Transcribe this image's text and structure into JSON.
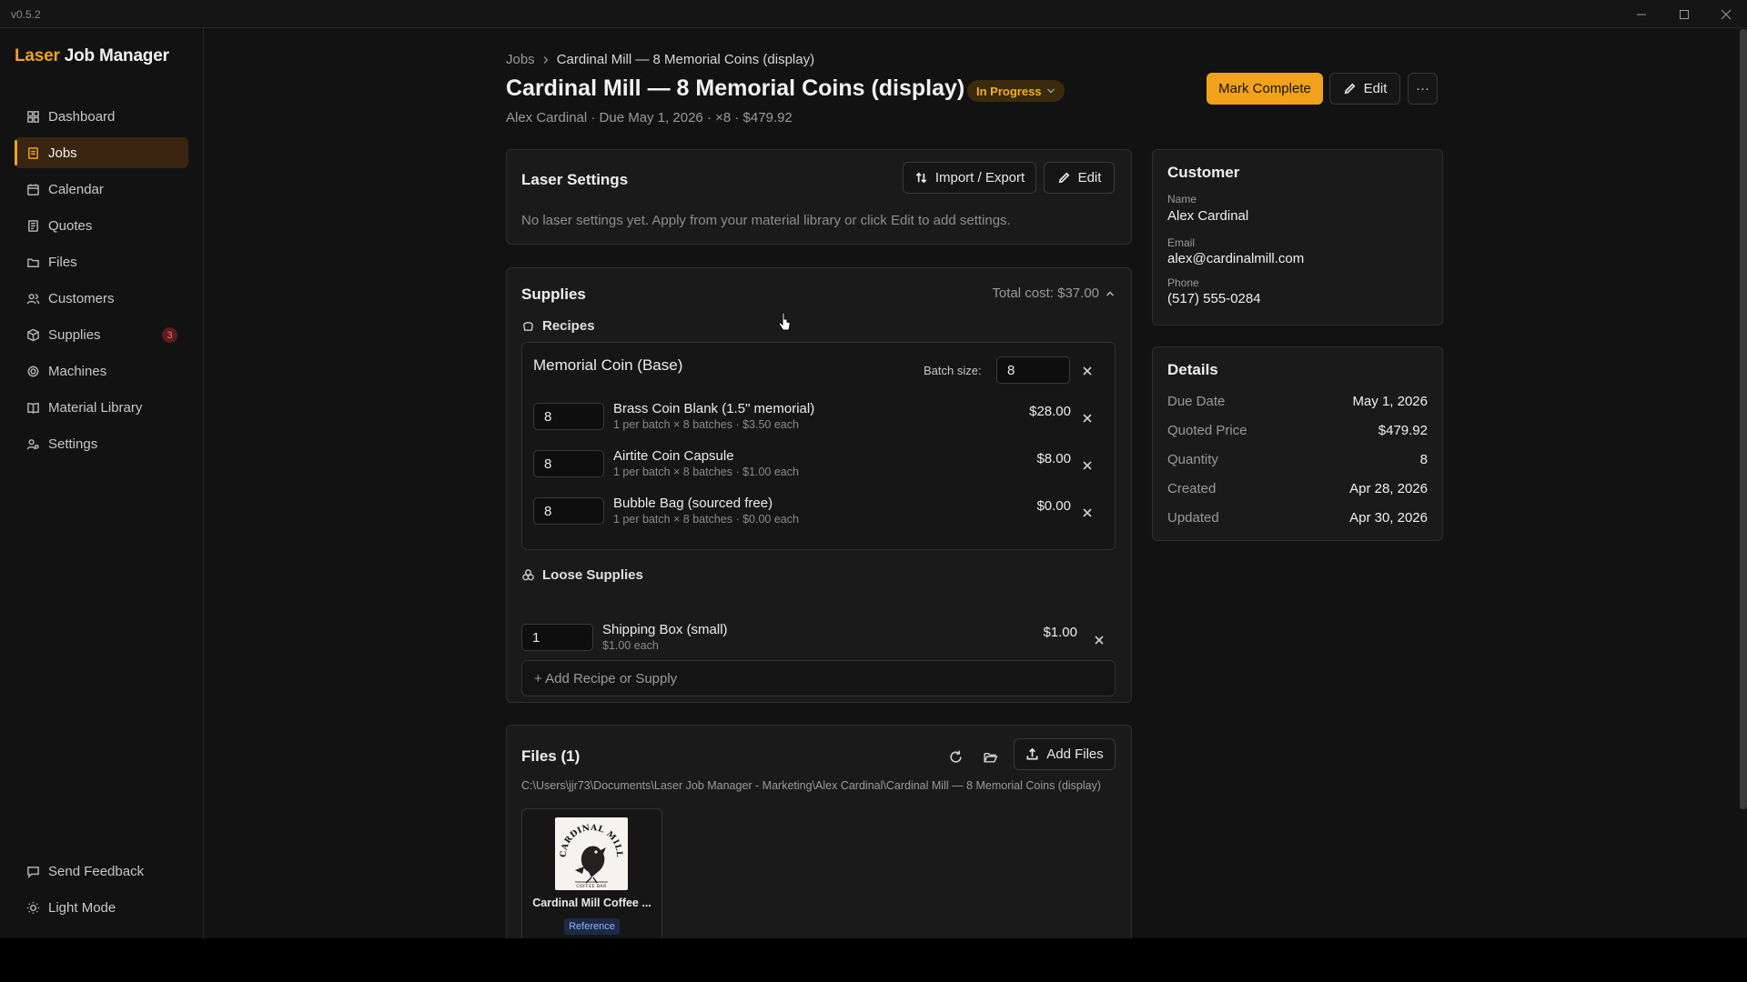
{
  "app": {
    "version": "v0.5.2",
    "brand_accent": "Laser",
    "brand_rest": " Job Manager",
    "accent_color": "#f0a21b"
  },
  "sidebar": {
    "items": [
      {
        "label": "Dashboard",
        "icon": "dashboard-icon"
      },
      {
        "label": "Jobs",
        "icon": "jobs-icon",
        "active": true
      },
      {
        "label": "Calendar",
        "icon": "calendar-icon"
      },
      {
        "label": "Quotes",
        "icon": "quotes-icon"
      },
      {
        "label": "Files",
        "icon": "folder-icon"
      },
      {
        "label": "Customers",
        "icon": "customers-icon"
      },
      {
        "label": "Supplies",
        "icon": "supplies-icon",
        "badge": "3"
      },
      {
        "label": "Machines",
        "icon": "machine-icon"
      },
      {
        "label": "Material Library",
        "icon": "book-icon"
      },
      {
        "label": "Settings",
        "icon": "settings-icon"
      }
    ],
    "feedback": "Send Feedback",
    "theme_toggle": "Light Mode"
  },
  "header": {
    "breadcrumb_root": "Jobs",
    "breadcrumb_current": "Cardinal Mill — 8 Memorial Coins (display)",
    "title": "Cardinal Mill — 8 Memorial Coins (display)",
    "status": "In Progress",
    "subtitle": "Alex Cardinal · Due May 1, 2026 · ×8 · $479.92",
    "mark_complete": "Mark Complete",
    "edit": "Edit",
    "more": "···"
  },
  "laser_settings": {
    "title": "Laser Settings",
    "import_export": "Import / Export",
    "edit": "Edit",
    "empty": "No laser settings yet. Apply from your material library or click Edit to add settings."
  },
  "supplies": {
    "title": "Supplies",
    "total": "Total cost: $37.00",
    "recipes_label": "Recipes",
    "recipe": {
      "name": "Memorial Coin (Base)",
      "batch_label": "Batch size:",
      "batch_value": "8",
      "items": [
        {
          "qty": "8",
          "name": "Brass Coin Blank (1.5\" memorial)",
          "sub": "1 per batch × 8 batches  ·  $3.50 each",
          "price": "$28.00"
        },
        {
          "qty": "8",
          "name": "Airtite Coin Capsule",
          "sub": "1 per batch × 8 batches  ·  $1.00 each",
          "price": "$8.00"
        },
        {
          "qty": "8",
          "name": "Bubble Bag (sourced free)",
          "sub": "1 per batch × 8 batches  ·  $0.00 each",
          "price": "$0.00"
        }
      ]
    },
    "loose_label": "Loose Supplies",
    "loose": [
      {
        "qty": "1",
        "name": "Shipping Box (small)",
        "sub": "$1.00 each",
        "price": "$1.00"
      }
    ],
    "add_label": "+ Add Recipe or Supply"
  },
  "files": {
    "title": "Files (1)",
    "add": "Add Files",
    "path": "C:\\Users\\jjr73\\Documents\\Laser Job Manager - Marketing\\Alex Cardinal\\Cardinal Mill — 8 Memorial Coins (display)",
    "items": [
      {
        "name": "Cardinal Mill Coffee ...",
        "tag": "Reference",
        "logo_text": "CARDINAL MILL",
        "logo_sub": "COFFEE BAR"
      }
    ]
  },
  "customer": {
    "title": "Customer",
    "name_label": "Name",
    "name": "Alex Cardinal",
    "email_label": "Email",
    "email": "alex@cardinalmill.com",
    "phone_label": "Phone",
    "phone": "(517) 555-0284"
  },
  "details": {
    "title": "Details",
    "rows": [
      {
        "k": "Due Date",
        "v": "May 1, 2026"
      },
      {
        "k": "Quoted Price",
        "v": "$479.92"
      },
      {
        "k": "Quantity",
        "v": "8"
      },
      {
        "k": "Created",
        "v": "Apr 28, 2026"
      },
      {
        "k": "Updated",
        "v": "Apr 30, 2026"
      }
    ]
  }
}
